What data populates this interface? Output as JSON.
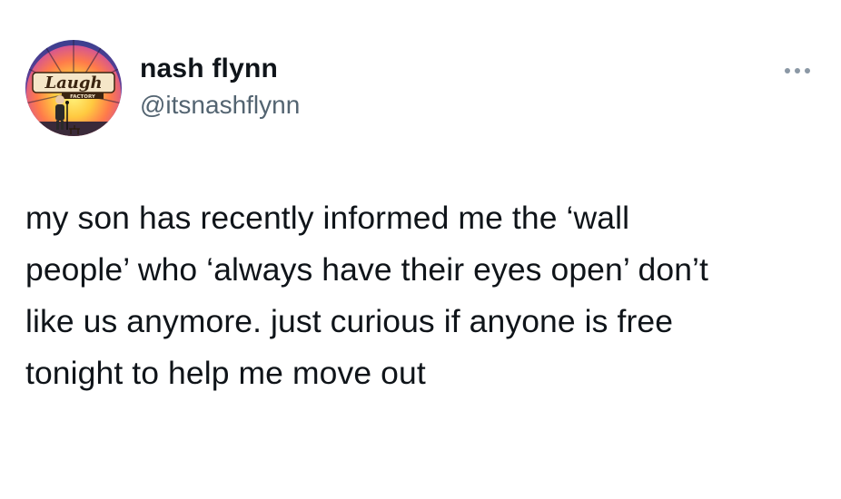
{
  "tweet": {
    "author": {
      "display_name": "nash flynn",
      "handle": "@itsnashflynn",
      "avatar": {
        "icon": "laugh-factory-logo-avatar",
        "logo_text": "Laugh",
        "logo_subtext": "FACTORY"
      }
    },
    "more_icon": "more-horizontal-icon",
    "text": "my son has recently informed me the ‘wall\npeople’ who ‘always have their eyes open’ don’t\nlike us anymore. just curious if anyone is free\ntonight to help me move out",
    "colors": {
      "text": "#0f1419",
      "handle": "#536471",
      "more_dots": "#8b98a5",
      "background": "#ffffff"
    }
  }
}
